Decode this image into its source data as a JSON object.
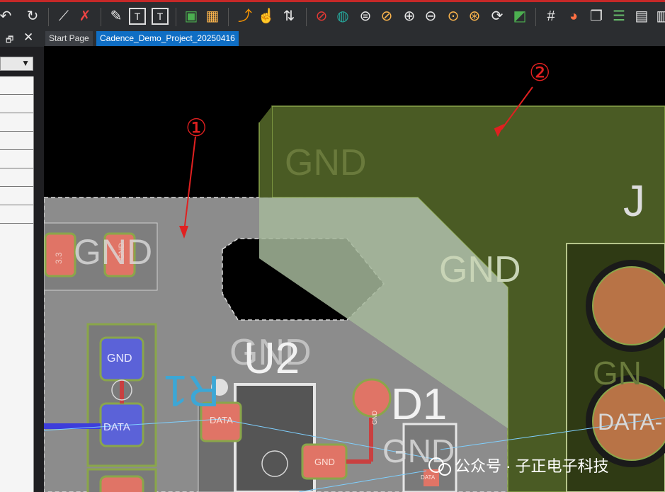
{
  "toolbar": {
    "icons": [
      "undo-icon",
      "redo-icon",
      "pin-icon",
      "unpin-icon",
      "add-line-icon",
      "add-text-icon",
      "edit-text-icon",
      "component-icon",
      "chip-icon",
      "route-icon",
      "hand-route-icon",
      "swap-icon",
      "drc-icon",
      "board-icon",
      "zoom-fit-icon",
      "zoom-area-icon",
      "zoom-in-icon",
      "zoom-out-icon",
      "zoom-previous-icon",
      "zoom-world-icon",
      "refresh-icon",
      "3d-view-icon",
      "grid-icon",
      "color-icon",
      "visibility-icon",
      "layers-icon",
      "report-icon"
    ]
  },
  "panel": {
    "close": "✕",
    "float": "🗗"
  },
  "tabs": [
    {
      "label": "Start Page"
    },
    {
      "label": "Cadence_Demo_Project_20250416"
    }
  ],
  "canvas": {
    "callouts": [
      "①",
      "②"
    ],
    "labels": {
      "gnd_pour": "GND",
      "gnd_overlap": "GND",
      "gnd_cap": "GND",
      "u2": "U2",
      "u2_gnd": "GND",
      "r1": "R1",
      "d1": "D1",
      "d1_gnd": "GND",
      "pad_33": "3.3",
      "pad_gnd_rot": "GND",
      "r_pad_gnd": "GND",
      "r_pad_data": "DATA",
      "u2_pad_data": "DATA",
      "u2_pad_gnd": "GND",
      "d1_pad_gnd": "GND",
      "d1_pad_data": "DATA",
      "conn_gnd": "GN",
      "conn_data": "DATA-",
      "j": "J"
    },
    "watermark": "公众号 · 子正电子科技"
  },
  "colors": {
    "tab_active": "#0f6ec4",
    "callout": "#e02020",
    "pour_gray": "#8c8c8c",
    "pour_green": "#4a5b24"
  }
}
